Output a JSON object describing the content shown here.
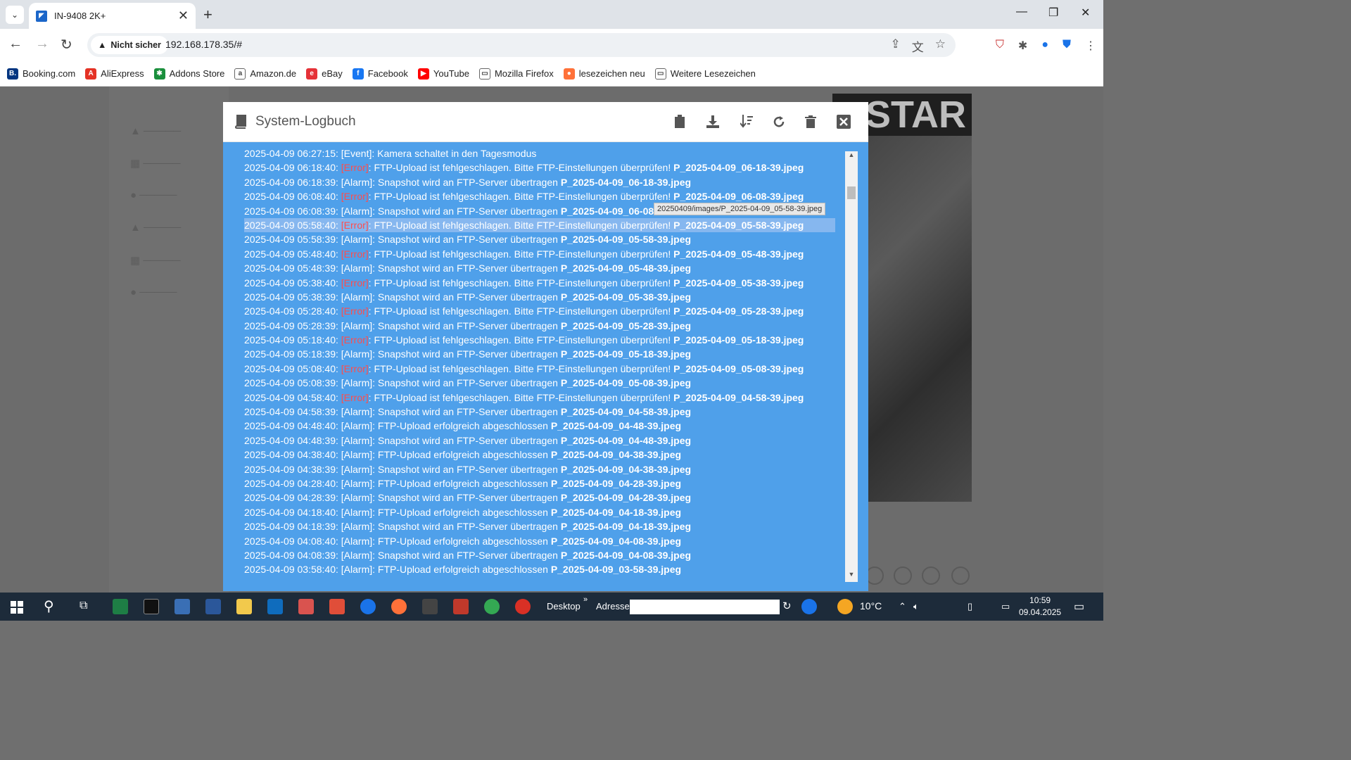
{
  "browser": {
    "tab_title": "IN-9408 2K+",
    "security_label": "Nicht sicher",
    "url": "192.168.178.35/#",
    "bookmarks": [
      {
        "label": "Booking.com",
        "icon": "booking-icon",
        "color": "#003580",
        "glyph": "B."
      },
      {
        "label": "AliExpress",
        "icon": "aliexpress-icon",
        "color": "#e43225",
        "glyph": "A"
      },
      {
        "label": "Addons Store",
        "icon": "addons-icon",
        "color": "#1a8f3c",
        "glyph": "✱"
      },
      {
        "label": "Amazon.de",
        "icon": "amazon-icon",
        "color": "#ffffff",
        "glyph": "a"
      },
      {
        "label": "eBay",
        "icon": "ebay-icon",
        "color": "#e53238",
        "glyph": "e"
      },
      {
        "label": "Facebook",
        "icon": "facebook-icon",
        "color": "#1877f2",
        "glyph": "f"
      },
      {
        "label": "YouTube",
        "icon": "youtube-icon",
        "color": "#ff0000",
        "glyph": "▶"
      },
      {
        "label": "Mozilla Firefox",
        "icon": "folder-icon",
        "color": "#ffffff",
        "glyph": "▭"
      },
      {
        "label": "lesezeichen neu",
        "icon": "firefox-icon",
        "color": "#ff7139",
        "glyph": "●"
      },
      {
        "label": "Weitere Lesezeichen",
        "icon": "folder-icon",
        "color": "#ffffff",
        "glyph": "▭"
      }
    ]
  },
  "modal": {
    "title": "System-Logbuch",
    "tooltip": "20250409/images/P_2025-04-09_05-58-39.jpeg",
    "rows": [
      {
        "ts": "2025-04-09 06:27:15: ",
        "tag": "[Event]",
        "err": false,
        "msg": ": Kamera schaltet in den Tagesmodus",
        "file": ""
      },
      {
        "ts": "2025-04-09 06:18:40: ",
        "tag": "[Error]",
        "err": true,
        "msg": ": FTP-Upload ist fehlgeschlagen. Bitte FTP-Einstellungen überprüfen! ",
        "file": "P_2025-04-09_06-18-39.jpeg"
      },
      {
        "ts": "2025-04-09 06:18:39: ",
        "tag": "[Alarm]",
        "err": false,
        "msg": ": Snapshot wird an FTP-Server übertragen ",
        "file": "P_2025-04-09_06-18-39.jpeg"
      },
      {
        "ts": "2025-04-09 06:08:40: ",
        "tag": "[Error]",
        "err": true,
        "msg": ": FTP-Upload ist fehlgeschlagen. Bitte FTP-Einstellungen überprüfen! ",
        "file": "P_2025-04-09_06-08-39.jpeg"
      },
      {
        "ts": "2025-04-09 06:08:39: ",
        "tag": "[Alarm]",
        "err": false,
        "msg": ": Snapshot wird an FTP-Server übertragen ",
        "file": "P_2025-04-09_06-08"
      },
      {
        "ts": "2025-04-09 05:58:40: ",
        "tag": "[Error]",
        "err": true,
        "msg": ": FTP-Upload ist fehlgeschlagen. Bitte FTP-Einstellungen überprüfen! ",
        "file": "P_2025-04-09_05-58-39.jpeg",
        "highlight": true
      },
      {
        "ts": "2025-04-09 05:58:39: ",
        "tag": "[Alarm]",
        "err": false,
        "msg": ": Snapshot wird an FTP-Server übertragen ",
        "file": "P_2025-04-09_05-58-39.jpeg"
      },
      {
        "ts": "2025-04-09 05:48:40: ",
        "tag": "[Error]",
        "err": true,
        "msg": ": FTP-Upload ist fehlgeschlagen. Bitte FTP-Einstellungen überprüfen! ",
        "file": "P_2025-04-09_05-48-39.jpeg"
      },
      {
        "ts": "2025-04-09 05:48:39: ",
        "tag": "[Alarm]",
        "err": false,
        "msg": ": Snapshot wird an FTP-Server übertragen ",
        "file": "P_2025-04-09_05-48-39.jpeg"
      },
      {
        "ts": "2025-04-09 05:38:40: ",
        "tag": "[Error]",
        "err": true,
        "msg": ": FTP-Upload ist fehlgeschlagen. Bitte FTP-Einstellungen überprüfen! ",
        "file": "P_2025-04-09_05-38-39.jpeg"
      },
      {
        "ts": "2025-04-09 05:38:39: ",
        "tag": "[Alarm]",
        "err": false,
        "msg": ": Snapshot wird an FTP-Server übertragen ",
        "file": "P_2025-04-09_05-38-39.jpeg"
      },
      {
        "ts": "2025-04-09 05:28:40: ",
        "tag": "[Error]",
        "err": true,
        "msg": ": FTP-Upload ist fehlgeschlagen. Bitte FTP-Einstellungen überprüfen! ",
        "file": "P_2025-04-09_05-28-39.jpeg"
      },
      {
        "ts": "2025-04-09 05:28:39: ",
        "tag": "[Alarm]",
        "err": false,
        "msg": ": Snapshot wird an FTP-Server übertragen ",
        "file": "P_2025-04-09_05-28-39.jpeg"
      },
      {
        "ts": "2025-04-09 05:18:40: ",
        "tag": "[Error]",
        "err": true,
        "msg": ": FTP-Upload ist fehlgeschlagen. Bitte FTP-Einstellungen überprüfen! ",
        "file": "P_2025-04-09_05-18-39.jpeg"
      },
      {
        "ts": "2025-04-09 05:18:39: ",
        "tag": "[Alarm]",
        "err": false,
        "msg": ": Snapshot wird an FTP-Server übertragen ",
        "file": "P_2025-04-09_05-18-39.jpeg"
      },
      {
        "ts": "2025-04-09 05:08:40: ",
        "tag": "[Error]",
        "err": true,
        "msg": ": FTP-Upload ist fehlgeschlagen. Bitte FTP-Einstellungen überprüfen! ",
        "file": "P_2025-04-09_05-08-39.jpeg"
      },
      {
        "ts": "2025-04-09 05:08:39: ",
        "tag": "[Alarm]",
        "err": false,
        "msg": ": Snapshot wird an FTP-Server übertragen ",
        "file": "P_2025-04-09_05-08-39.jpeg"
      },
      {
        "ts": "2025-04-09 04:58:40: ",
        "tag": "[Error]",
        "err": true,
        "msg": ": FTP-Upload ist fehlgeschlagen. Bitte FTP-Einstellungen überprüfen! ",
        "file": "P_2025-04-09_04-58-39.jpeg"
      },
      {
        "ts": "2025-04-09 04:58:39: ",
        "tag": "[Alarm]",
        "err": false,
        "msg": ": Snapshot wird an FTP-Server übertragen ",
        "file": "P_2025-04-09_04-58-39.jpeg"
      },
      {
        "ts": "2025-04-09 04:48:40: ",
        "tag": "[Alarm]",
        "err": false,
        "msg": ": FTP-Upload erfolgreich abgeschlossen ",
        "file": "P_2025-04-09_04-48-39.jpeg"
      },
      {
        "ts": "2025-04-09 04:48:39: ",
        "tag": "[Alarm]",
        "err": false,
        "msg": ": Snapshot wird an FTP-Server übertragen ",
        "file": "P_2025-04-09_04-48-39.jpeg"
      },
      {
        "ts": "2025-04-09 04:38:40: ",
        "tag": "[Alarm]",
        "err": false,
        "msg": ": FTP-Upload erfolgreich abgeschlossen ",
        "file": "P_2025-04-09_04-38-39.jpeg"
      },
      {
        "ts": "2025-04-09 04:38:39: ",
        "tag": "[Alarm]",
        "err": false,
        "msg": ": Snapshot wird an FTP-Server übertragen ",
        "file": "P_2025-04-09_04-38-39.jpeg"
      },
      {
        "ts": "2025-04-09 04:28:40: ",
        "tag": "[Alarm]",
        "err": false,
        "msg": ": FTP-Upload erfolgreich abgeschlossen ",
        "file": "P_2025-04-09_04-28-39.jpeg"
      },
      {
        "ts": "2025-04-09 04:28:39: ",
        "tag": "[Alarm]",
        "err": false,
        "msg": ": Snapshot wird an FTP-Server übertragen ",
        "file": "P_2025-04-09_04-28-39.jpeg"
      },
      {
        "ts": "2025-04-09 04:18:40: ",
        "tag": "[Alarm]",
        "err": false,
        "msg": ": FTP-Upload erfolgreich abgeschlossen ",
        "file": "P_2025-04-09_04-18-39.jpeg"
      },
      {
        "ts": "2025-04-09 04:18:39: ",
        "tag": "[Alarm]",
        "err": false,
        "msg": ": Snapshot wird an FTP-Server übertragen ",
        "file": "P_2025-04-09_04-18-39.jpeg"
      },
      {
        "ts": "2025-04-09 04:08:40: ",
        "tag": "[Alarm]",
        "err": false,
        "msg": ": FTP-Upload erfolgreich abgeschlossen ",
        "file": "P_2025-04-09_04-08-39.jpeg"
      },
      {
        "ts": "2025-04-09 04:08:39: ",
        "tag": "[Alarm]",
        "err": false,
        "msg": ": Snapshot wird an FTP-Server übertragen ",
        "file": "P_2025-04-09_04-08-39.jpeg"
      },
      {
        "ts": "2025-04-09 03:58:40: ",
        "tag": "[Alarm]",
        "err": false,
        "msg": ": FTP-Upload erfolgreich abgeschlossen ",
        "file": "P_2025-04-09_03-58-39.jpeg"
      }
    ]
  },
  "taskbar": {
    "desktop_label": "Desktop",
    "address_label": "Adresse",
    "temperature": "10°C",
    "time": "10:59",
    "date": "09.04.2025"
  },
  "colors": {
    "modal_body": "#4fa0ea",
    "error_text": "#ff4c4c",
    "taskbar": "#1d2b3a"
  }
}
